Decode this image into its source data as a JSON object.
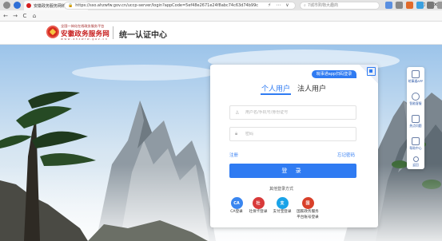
{
  "browser": {
    "tab_title": "安徽政务服务网统一认证中心",
    "tab_close": "×",
    "new_tab": "+",
    "url": "https://sso.ahzwfw.gov.cn/uccp-server/login?appCode=5ef48e2671e24f8abc74c63d74b99c",
    "url_lock": "🔒",
    "url_extra": [
      "⚡",
      "⋯",
      "∨"
    ],
    "search_placeholder": "7城市购物大趣商",
    "nav": {
      "back": "←",
      "forward": "→",
      "reload": "C",
      "home": "⌂"
    },
    "window_controls": {
      "menu": "☰",
      "minimize": "—",
      "maximize": "☐",
      "close": "✕"
    },
    "colors": {
      "tabbar": "#e4e4e4",
      "navbar": "#f7f7f7"
    }
  },
  "header": {
    "logo_small": "全国一体化在线政务服务平台",
    "logo_main": "安徽政务服务网",
    "logo_url": "www.ahzwfw.gov.cn",
    "title": "统一认证中心"
  },
  "login": {
    "app_login_badge": "皖事通app扫码登录",
    "tabs": {
      "personal": "个人用户",
      "legal": "法人用户"
    },
    "username_placeholder": "用户名/手机号/身份证号",
    "password_placeholder": "密码",
    "register_link": "注册",
    "forgot_link": "忘记密码",
    "login_button": "登 录",
    "other_title": "其他登录方式",
    "alt_methods": [
      {
        "label": "CA登录",
        "icon_text": "CA",
        "color": "#3a86f0"
      },
      {
        "label": "社保卡登录",
        "icon_text": "社",
        "color": "#d83a3a"
      },
      {
        "label": "支付宝登录",
        "icon_text": "支",
        "color": "#1aa3e8"
      },
      {
        "label": "国家政务服务平台账号登录",
        "label_line1": "国家政务服务",
        "label_line2": "平台账号登录",
        "icon_text": "国",
        "color": "#d8402a"
      }
    ],
    "accent": "#2f7bf2"
  },
  "floatbar": {
    "items": [
      "皖事通APP",
      "智能客服",
      "热点问题",
      "帮助中心",
      "返回"
    ]
  }
}
